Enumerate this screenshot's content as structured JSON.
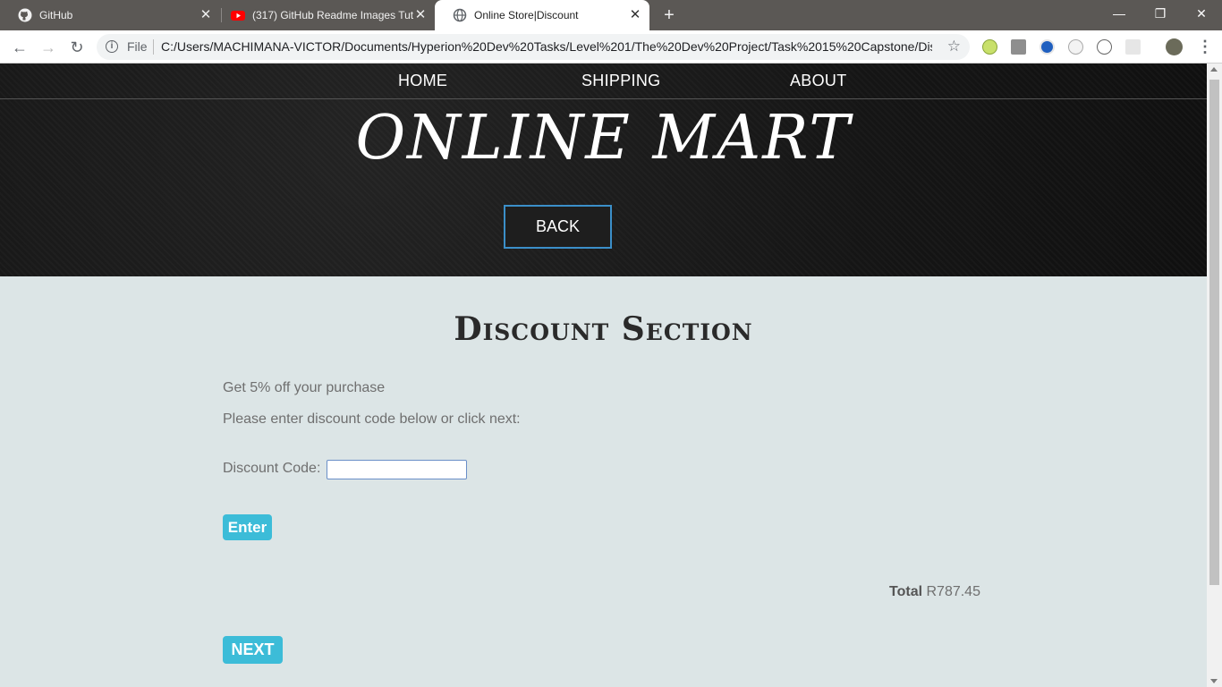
{
  "browser": {
    "tabs": [
      {
        "title": "GitHub",
        "icon": "github-icon"
      },
      {
        "title": "(317) GitHub Readme Images Tut",
        "icon": "youtube-icon"
      },
      {
        "title": "Online Store|Discount",
        "icon": "globe-icon",
        "active": true
      }
    ],
    "new_tab": "+",
    "window_controls": {
      "minimize": "—",
      "restore": "❐",
      "close": "✕"
    },
    "address": {
      "protocol_label": "File",
      "url": "C:/Users/MACHIMANA-VICTOR/Documents/Hyperion%20Dev%20Tasks/Level%201/The%20Dev%20Project/Task%2015%20Capstone/Disc..."
    }
  },
  "page": {
    "nav": {
      "home": "HOME",
      "shipping": "SHIPPING",
      "about": "ABOUT"
    },
    "brand": "ONLINE MART",
    "back_button": "BACK",
    "section_title": "Discount Section",
    "offer_text": "Get 5% off your purchase",
    "instruction_text": "Please enter discount code below or click next:",
    "discount_label": "Discount Code:",
    "discount_value": "",
    "enter_button": "Enter",
    "total_label": "Total",
    "total_value": "R787.45",
    "next_button": "NEXT"
  },
  "colors": {
    "accent": "#3cbcd8",
    "page_bg": "#dce5e6",
    "hero_bg": "#151515",
    "back_border": "#3b8fc9"
  }
}
